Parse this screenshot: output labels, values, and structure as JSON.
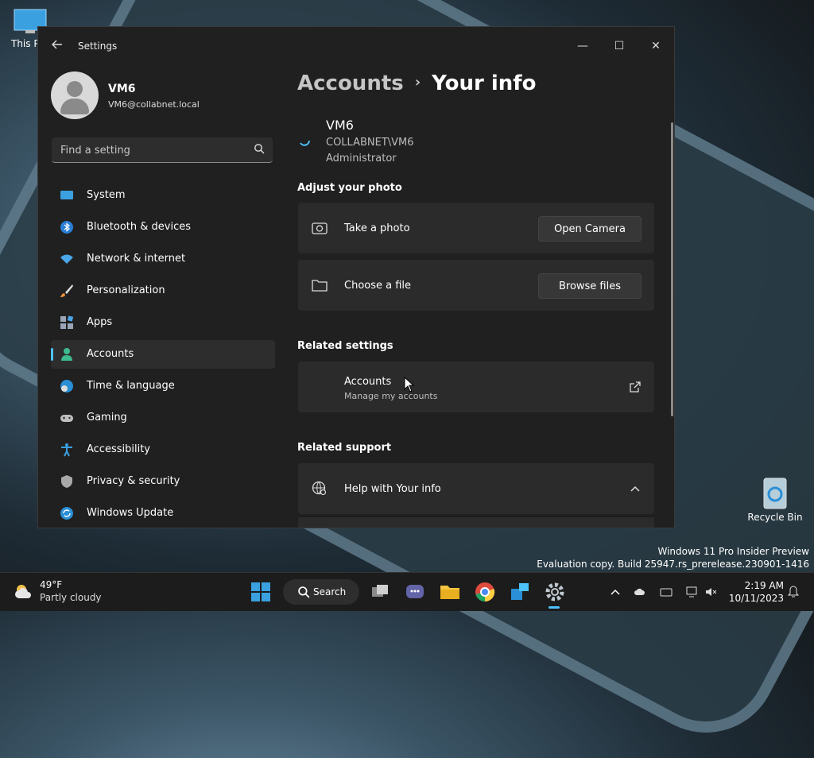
{
  "desktop": {
    "this_pc_label": "This P",
    "recycle_bin_label": "Recycle Bin",
    "watermark": {
      "line1": "Windows 11 Pro Insider Preview",
      "line2": "Evaluation copy. Build 25947.rs_prerelease.230901-1416"
    }
  },
  "window": {
    "title": "Settings",
    "back_icon": "back-arrow-icon",
    "controls": {
      "minimize": "—",
      "maximize": "☐",
      "close": "✕"
    }
  },
  "sidebar": {
    "profile": {
      "name": "VM6",
      "email": "VM6@collabnet.local"
    },
    "search_placeholder": "Find a setting",
    "items": [
      {
        "label": "System",
        "icon": "system-icon"
      },
      {
        "label": "Bluetooth & devices",
        "icon": "bluetooth-icon"
      },
      {
        "label": "Network & internet",
        "icon": "wifi-icon"
      },
      {
        "label": "Personalization",
        "icon": "brush-icon"
      },
      {
        "label": "Apps",
        "icon": "apps-icon"
      },
      {
        "label": "Accounts",
        "icon": "accounts-icon",
        "active": true
      },
      {
        "label": "Time & language",
        "icon": "globe-clock-icon"
      },
      {
        "label": "Gaming",
        "icon": "gamepad-icon"
      },
      {
        "label": "Accessibility",
        "icon": "accessibility-icon"
      },
      {
        "label": "Privacy & security",
        "icon": "shield-icon"
      },
      {
        "label": "Windows Update",
        "icon": "update-icon"
      }
    ]
  },
  "main": {
    "breadcrumb": {
      "parent": "Accounts",
      "separator": "›",
      "current": "Your info"
    },
    "user": {
      "name": "VM6",
      "domain": "COLLABNET\\VM6",
      "role": "Administrator"
    },
    "adjust_photo": {
      "title": "Adjust your photo",
      "take_photo": {
        "label": "Take a photo",
        "button": "Open Camera"
      },
      "choose_file": {
        "label": "Choose a file",
        "button": "Browse files"
      }
    },
    "related_settings": {
      "title": "Related settings",
      "accounts": {
        "title": "Accounts",
        "subtitle": "Manage my accounts"
      }
    },
    "related_support": {
      "title": "Related support",
      "help": {
        "label": "Help with Your info"
      }
    }
  },
  "taskbar": {
    "weather": {
      "temp": "49°F",
      "condition": "Partly cloudy"
    },
    "search_label": "Search",
    "clock": {
      "time": "2:19 AM",
      "date": "10/11/2023"
    }
  },
  "colors": {
    "accent": "#4cc2ff",
    "window_bg": "#202020",
    "card_bg": "#2b2b2b"
  }
}
